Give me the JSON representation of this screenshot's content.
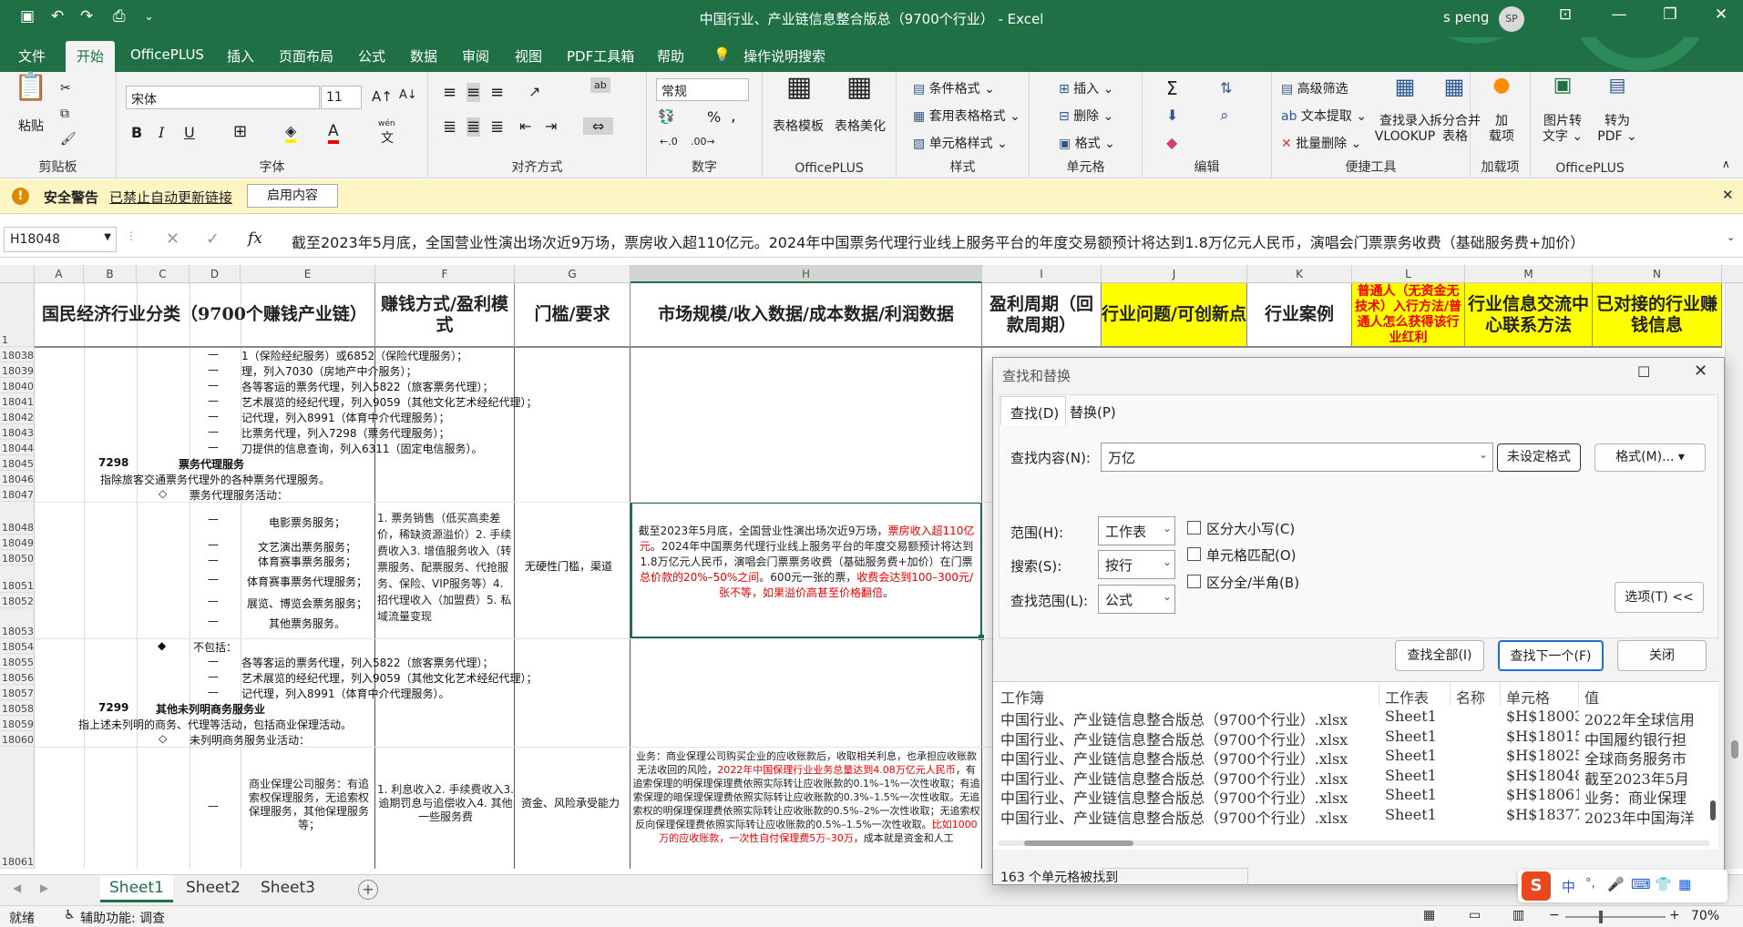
{
  "window": {
    "title": "中国行业、产业链信息整合版总（9700个行业） - Excel",
    "user": "s peng",
    "avatar_initials": "SP"
  },
  "menu": {
    "items": [
      "文件",
      "开始",
      "OfficePLUS",
      "插入",
      "页面布局",
      "公式",
      "数据",
      "审阅",
      "视图",
      "PDF工具箱",
      "帮助"
    ],
    "active": "开始",
    "tell_me": "操作说明搜索"
  },
  "ribbon": {
    "clipboard": {
      "label": "剪贴板",
      "paste": "粘贴"
    },
    "font": {
      "label": "字体",
      "name": "宋体",
      "size": "11",
      "bold": "B",
      "italic": "I",
      "underline": "U",
      "wen": "wén",
      "wen2": "文"
    },
    "alignment": {
      "label": "对齐方式",
      "ab": "ab"
    },
    "number": {
      "label": "数字",
      "format": "常规",
      "percent": "%",
      "comma": ","
    },
    "officeplus": {
      "label": "OfficePLUS",
      "b1": "表格模板",
      "b2": "表格美化"
    },
    "styles": {
      "label": "样式",
      "b1": "条件格式",
      "b2": "套用表格格式",
      "b3": "单元格样式"
    },
    "cells": {
      "label": "单元格",
      "b1": "插入",
      "b2": "删除",
      "b3": "格式"
    },
    "editing": {
      "label": "编辑",
      "sigma": "Σ"
    },
    "tools": {
      "label": "便捷工具",
      "b1": "高级筛选",
      "b2": "文本提取",
      "b3": "批量删除",
      "b4": "查找录入",
      "b4b": "VLOOKUP",
      "b5": "拆分合并",
      "b5b": "表格"
    },
    "addins": {
      "label": "加载项",
      "b1": "加",
      "b1b": "载项"
    },
    "officeplus2": {
      "label": "OfficePLUS",
      "b1": "图片转",
      "b1b": "文字",
      "b2": "转为",
      "b2b": "PDF"
    }
  },
  "security": {
    "label": "安全警告",
    "message": "已禁止自动更新链接",
    "button": "启用内容"
  },
  "formula_bar": {
    "cell_ref": "H18048",
    "fx": "fx",
    "cancel": "✕",
    "confirm": "✓",
    "content": "截至2023年5月底，全国营业性演出场次近9万场，票房收入超110亿元。2024年中国票务代理行业线上服务平台的年度交易额预计将达到1.8万亿元人民币，演唱会门票票务收费（基础服务费+加价）"
  },
  "columns": [
    "A",
    "B",
    "C",
    "D",
    "E",
    "F",
    "G",
    "H",
    "I",
    "J",
    "K",
    "L",
    "M",
    "N"
  ],
  "header_row": {
    "num": "1",
    "E": "国民经济行业分类（9700个赚钱产业链）",
    "F": "赚钱方式/盈利模式",
    "G": "门槛/要求",
    "H": "市场规模/收入数据/成本数据/利润数据",
    "I": "盈利周期（回款周期）",
    "J": "行业问题/可创新点",
    "K": "行业案例",
    "L": "普通人（无资金无技术）入行方法/普通人怎么获得该行业红利",
    "M": "行业信息交流中心联系方法",
    "N": "已对接的行业赚钱信息"
  },
  "rows": [
    {
      "n": "18038",
      "d": "—",
      "e": "1（保险经纪服务）或6852（保险代理服务）；"
    },
    {
      "n": "18039",
      "d": "—",
      "e": "理，列入7030（房地产中介服务）；"
    },
    {
      "n": "18040",
      "d": "—",
      "e": "各等客运的票务代理，列入5822（旅客票务代理）；"
    },
    {
      "n": "18041",
      "d": "—",
      "e": "艺术展览的经纪代理，列入9059（其他文化艺术经纪代理）；"
    },
    {
      "n": "18042",
      "d": "—",
      "e": "记代理，列入8991（体育中介代理服务）；"
    },
    {
      "n": "18043",
      "d": "—",
      "e": "比票务代理，列入7298（票务代理服务）；"
    },
    {
      "n": "18044",
      "d": "—",
      "e": "刀提供的信息查询，列入6311（固定电信服务）。"
    },
    {
      "n": "18045",
      "b": "7298",
      "c": "票务代理服务"
    },
    {
      "n": "18046",
      "a": "指除旅客交通票务代理外的各种票务代理服务。"
    },
    {
      "n": "18047",
      "c": "◇",
      "d": "票务代理服务活动："
    }
  ],
  "block1": {
    "rows": [
      "18048",
      "18049",
      "18050",
      "18051",
      "18052",
      "18053"
    ],
    "dash": "—",
    "items": [
      "电影票务服务；",
      "文艺演出票务服务；",
      "体育赛事票务服务；",
      "体育赛事票务代理服务；",
      "展览、博览会票务服务；",
      "其他票务服务。"
    ],
    "f": "1. 票务销售（低买高卖差价，稀缺资源溢价）2. 手续费收入3. 增值服务收入（转票服务、配票服务、代抢服务、保险、VIP服务等）4. 招代理收入（加盟费）5. 私域流量变现",
    "g": "无硬性门槛，渠道",
    "h_parts": [
      [
        "截至2023年5月底，全国营业性演出场次近9万场，",
        false
      ],
      [
        "票房收入超110亿元",
        true
      ],
      [
        "。2024年中国票务代理行业线上服务平台的年度交易额预计将达到1.8万亿元人民币，演唱会门票票务收费（基础服务费+加价）在门票",
        false
      ],
      [
        "总价款的20%–50%之间",
        true
      ],
      [
        "。600元一张的票，",
        false
      ],
      [
        "收费会达到100–300元/张不等，如果溢价高甚至价格翻倍",
        true
      ],
      [
        "。",
        false
      ]
    ]
  },
  "rows2": [
    {
      "n": "18054",
      "c": "◆",
      "d": "不包括："
    },
    {
      "n": "18055",
      "d": "—",
      "e": "各等客运的票务代理，列入5822（旅客票务代理）；"
    },
    {
      "n": "18056",
      "d": "—",
      "e": "艺术展览的经纪代理，列入9059（其他文化艺术经纪代理）；"
    },
    {
      "n": "18057",
      "d": "—",
      "e": "记代理，列入8991（体育中介代理服务）。"
    },
    {
      "n": "18058",
      "b": "7299",
      "c": "其他未列明商务服务业"
    },
    {
      "n": "18059",
      "a": "指上述未列明的商务、代理等活动，包括商业保理活动。"
    },
    {
      "n": "18060",
      "c": "◇",
      "d": "未列明商务服务业活动："
    }
  ],
  "block2": {
    "n": "18061",
    "dash": "—",
    "e": "商业保理公司服务：有追索权保理服务，无追索权保理服务，其他保理服务等；",
    "f": "1. 利息收入2. 手续费收入3. 逾期罚息与追偿收入4. 其他一些服务费",
    "g": "资金、风险承受能力",
    "h_parts": [
      [
        "业务：商业保理公司购买企业的应收账款后，收取相关利息，也承担应收账款无法收回的风险，",
        false
      ],
      [
        "2022年中国保理行业业务总量达到4.08万亿元人民币",
        true
      ],
      [
        "，有追索保理的明保理保理费依照实际转让应收账款的0.1%–1%一次性收取；有追索保理的暗保理保理费依照实际转让应收账款的0.3%–1.5%一次性收取。无追索权的明保理保理费依照实际转让应收账款的0.5%–2%一次性收取；无追索权反向保理保理费依照实际转让应收账款的0.5%–1.5%一次性收取。",
        false
      ],
      [
        "比如1000万的应收账款，一次性自付保理费5万–30万",
        true
      ],
      [
        "，成本就是资金和人工",
        false
      ]
    ]
  },
  "sheets": {
    "tabs": [
      "Sheet1",
      "Sheet2",
      "Sheet3"
    ],
    "active": "Sheet1",
    "add": "+"
  },
  "status": {
    "ready": "就绪",
    "accessibility": "辅助功能: 调查",
    "zoom": "70%"
  },
  "dialog": {
    "title": "查找和替换",
    "tabs": [
      "查找(D)",
      "替换(P)"
    ],
    "find_label": "查找内容(N):",
    "find_value": "万亿",
    "no_format": "未设定格式",
    "format_btn": "格式(M)...",
    "scope_label": "范围(H):",
    "scope": "工作表",
    "search_label": "搜索(S):",
    "search": "按行",
    "lookin_label": "查找范围(L):",
    "lookin": "公式",
    "case": "区分大小写(C)",
    "whole": "单元格匹配(O)",
    "width": "区分全/半角(B)",
    "options_btn": "选项(T) <<",
    "find_all": "查找全部(I)",
    "find_next": "查找下一个(F)",
    "close": "关闭",
    "result_headers": [
      "工作簿",
      "工作表",
      "名称",
      "单元格",
      "值"
    ],
    "results": [
      {
        "book": "中国行业、产业链信息整合版总（9700个行业）.xlsx",
        "sheet": "Sheet1",
        "name": "",
        "cell": "$H$18003",
        "value": "2022年全球信用"
      },
      {
        "book": "中国行业、产业链信息整合版总（9700个行业）.xlsx",
        "sheet": "Sheet1",
        "name": "",
        "cell": "$H$18015",
        "value": "中国履约银行担"
      },
      {
        "book": "中国行业、产业链信息整合版总（9700个行业）.xlsx",
        "sheet": "Sheet1",
        "name": "",
        "cell": "$H$18025",
        "value": "全球商务服务市"
      },
      {
        "book": "中国行业、产业链信息整合版总（9700个行业）.xlsx",
        "sheet": "Sheet1",
        "name": "",
        "cell": "$H$18048",
        "value": "截至2023年5月"
      },
      {
        "book": "中国行业、产业链信息整合版总（9700个行业）.xlsx",
        "sheet": "Sheet1",
        "name": "",
        "cell": "$H$18061",
        "value": "业务：商业保理"
      },
      {
        "book": "中国行业、产业链信息整合版总（9700个行业）.xlsx",
        "sheet": "Sheet1",
        "name": "",
        "cell": "$H$18377",
        "value": "2023年中国海洋"
      }
    ],
    "found": "163 个单元格被找到"
  },
  "colors": {
    "excel_green": "#1f7145",
    "header_yellow": "#ffff00",
    "sec_bar": "#fdf5c4"
  }
}
